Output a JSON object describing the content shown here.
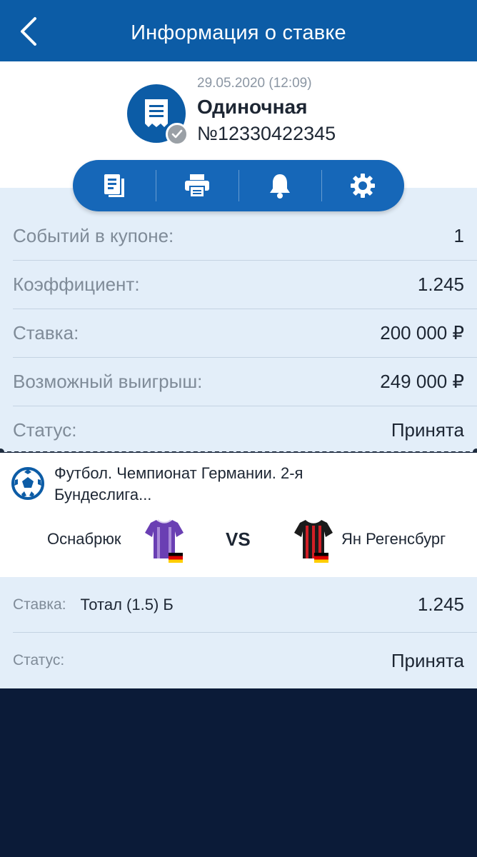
{
  "header": {
    "title": "Информация о ставке",
    "back_icon": "back-arrow-icon"
  },
  "bet": {
    "date": "29.05.2020 (12:09)",
    "type": "Одиночная",
    "number": "№12330422345"
  },
  "actions": [
    {
      "icon": "copy-icon"
    },
    {
      "icon": "print-icon"
    },
    {
      "icon": "bell-icon"
    },
    {
      "icon": "settings-icon"
    }
  ],
  "info": {
    "rows": [
      {
        "label": "Событий в купоне:",
        "value": "1"
      },
      {
        "label": "Коэффициент:",
        "value": "1.245"
      },
      {
        "label": "Ставка:",
        "value": "200 000 ₽"
      },
      {
        "label": "Возможный выигрыш:",
        "value": "249 000 ₽"
      },
      {
        "label": "Статус:",
        "value": "Принята"
      }
    ]
  },
  "event": {
    "title": "Футбол. Чемпионат Германии. 2-я Бундеслига...",
    "home": "Оснабрюк",
    "vs": "VS",
    "away": "Ян Регенсбург"
  },
  "selection": {
    "rows": [
      {
        "label": "Ставка:",
        "market": "Тотал (1.5) Б",
        "value": "1.245"
      },
      {
        "label": "Статус:",
        "market": "",
        "value": "Принята"
      }
    ]
  },
  "colors": {
    "header": "#0c5ca6",
    "actions_bar": "#1667b8",
    "panel": "#e3eef9",
    "footer": "#0b1b38"
  }
}
